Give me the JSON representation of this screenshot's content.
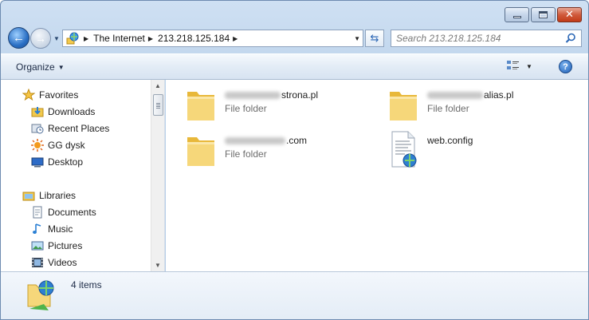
{
  "window": {
    "caption": {
      "minimize": "minimize",
      "maximize": "maximize",
      "close": "close"
    }
  },
  "address_bar": {
    "crumbs": [
      "The Internet",
      "213.218.125.184"
    ]
  },
  "search": {
    "placeholder": "Search 213.218.125.184"
  },
  "toolbar": {
    "organize_label": "Organize",
    "help_label": "?"
  },
  "navigation": {
    "favorites_header": "Favorites",
    "favorites": [
      "Downloads",
      "Recent Places",
      "GG dysk",
      "Desktop"
    ],
    "libraries_header": "Libraries",
    "libraries": [
      "Documents",
      "Music",
      "Pictures",
      "Videos"
    ]
  },
  "items": [
    {
      "name_visible": "strona.pl",
      "type": "File folder",
      "icon": "folder-icon"
    },
    {
      "name_visible": "alias.pl",
      "type": "File folder",
      "icon": "folder-icon"
    },
    {
      "name_visible": ".com",
      "type": "File folder",
      "icon": "folder-icon"
    },
    {
      "name_visible": "web.config",
      "type": "",
      "icon": "config-file-icon"
    }
  ],
  "status": {
    "item_count": "4 items"
  },
  "colors": {
    "accent": "#2a6fc4",
    "folder": "#f2c94c",
    "close": "#c23b18"
  }
}
